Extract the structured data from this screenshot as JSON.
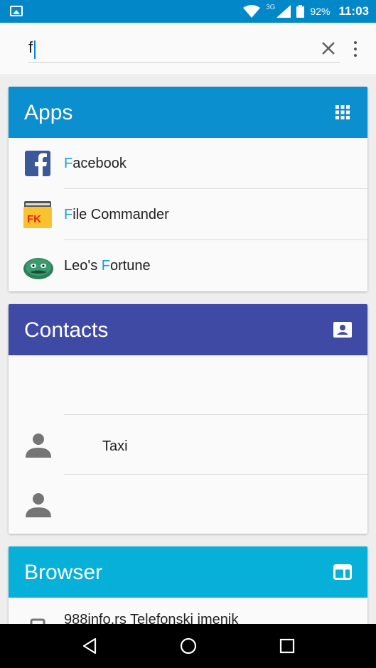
{
  "status_bar": {
    "network": "3G",
    "battery": "92%",
    "time": "11:03",
    "color": "#0288c8"
  },
  "search": {
    "value": "f",
    "placeholder": ""
  },
  "apps_section": {
    "title": "Apps",
    "color": "#0b8fcf",
    "items": [
      {
        "highlight": "F",
        "rest": "acebook",
        "prefix": "",
        "icon": "facebook-icon"
      },
      {
        "highlight": "F",
        "rest": "ile Commander",
        "prefix": "",
        "icon": "file-commander-icon"
      },
      {
        "highlight": "F",
        "rest": "ortune",
        "prefix": "Leo's ",
        "icon": "leos-fortune-icon"
      }
    ]
  },
  "contacts_section": {
    "title": "Contacts",
    "color": "#3f4aa5",
    "items": [
      {
        "label": "",
        "icon": ""
      },
      {
        "label": "Taxi",
        "icon": "person-icon"
      },
      {
        "label": "",
        "icon": "person-icon"
      }
    ]
  },
  "browser_section": {
    "title": "Browser",
    "color": "#06b0d8",
    "items": [
      {
        "label": "988info.rs Telefonski imenik",
        "icon": "bookmark-icon"
      }
    ]
  }
}
